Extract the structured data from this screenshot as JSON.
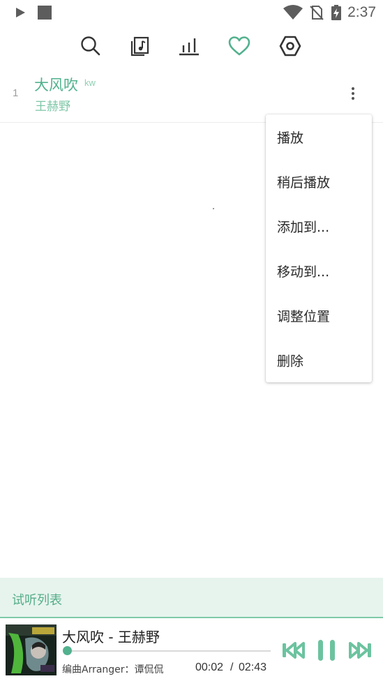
{
  "status_bar": {
    "time": "2:37",
    "icons": [
      "play-icon",
      "stop-icon",
      "wifi-icon",
      "no-sim-icon",
      "battery-charging-icon"
    ]
  },
  "toolbar": {
    "icons": [
      "search-icon",
      "music-library-icon",
      "chart-icon",
      "heart-icon",
      "settings-icon"
    ],
    "active_color": "#52b18e"
  },
  "song": {
    "index": "1",
    "title": "大风吹",
    "source": "kw",
    "artist": "王赫野"
  },
  "menu": {
    "items": [
      {
        "label": "播放"
      },
      {
        "label": "稍后播放"
      },
      {
        "label": "添加到..."
      },
      {
        "label": "移动到..."
      },
      {
        "label": "调整位置"
      },
      {
        "label": "删除"
      }
    ]
  },
  "list_header": {
    "label": "试听列表"
  },
  "player": {
    "now_playing": "大风吹 - 王赫野",
    "lyric": "编曲Arranger：谭侃侃",
    "time_current": "00:02",
    "time_separator": "/",
    "time_total": "02:43",
    "progress": 0.012,
    "controls": [
      "previous-icon",
      "pause-icon",
      "next-icon"
    ],
    "accent_color": "#6cc39f"
  },
  "colors": {
    "accent": "#52b18e",
    "header_bg": "#e7f4ee"
  }
}
